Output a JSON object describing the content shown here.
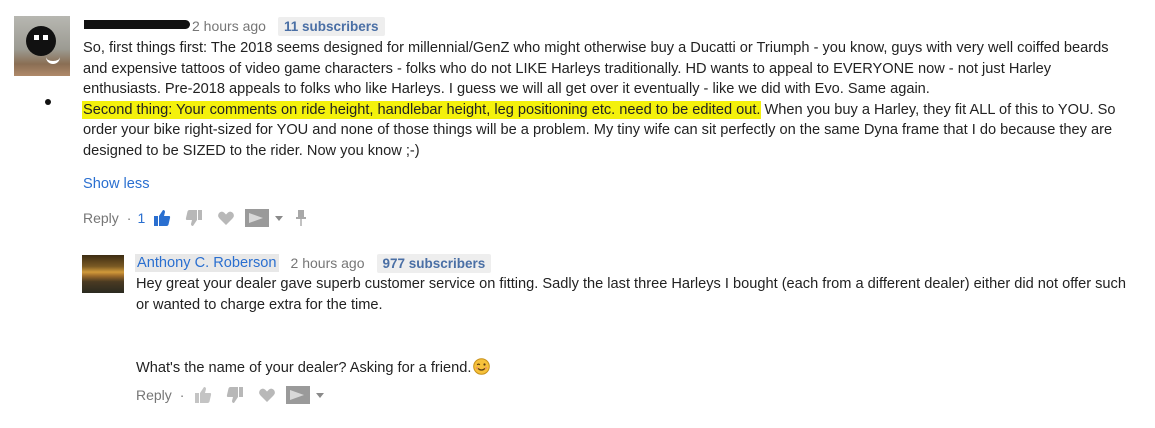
{
  "comment": {
    "time": "2 hours ago",
    "subscribers": "11 subscribers",
    "paragraph1": "So, first things first:  The 2018 seems designed for millennial/GenZ who might otherwise buy a Ducatti or Triumph - you know, guys with very well coiffed beards and expensive tattoos of video game characters - folks who do not LIKE Harleys traditionally.  HD wants to appeal to EVERYONE now - not just Harley enthusiasts.  Pre-2018 appeals to folks who like Harleys.  I guess we will all get over it eventually - like we did with Evo.  Same again.",
    "highlight": "Second thing:  Your comments on ride height, handlebar height, leg positioning etc. need to be edited out.",
    "paragraph2_rest": "  When you buy a Harley, they fit ALL of this to YOU.  So order your bike right-sized for YOU and none of those things will be a problem.  My tiny wife can sit perfectly on the same Dyna frame that I do because they are designed to be SIZED to the rider.  Now you know ;-)",
    "show_less": "Show less",
    "reply_label": "Reply",
    "separator": "·",
    "like_count": "1"
  },
  "reply": {
    "author": "Anthony C. Roberson",
    "time": "2 hours ago",
    "subscribers": "977 subscribers",
    "line1": "Hey great your dealer gave superb customer service on fitting. Sadly the last three Harleys I bought (each from a different dealer) either did not offer such or wanted to charge extra for the time.",
    "line2": "What's the name of your dealer? Asking for a friend.",
    "reply_label": "Reply",
    "separator": "·"
  },
  "colors": {
    "link_blue": "#2a6fd0",
    "highlight_yellow": "#f4f10c",
    "meta_gray": "#767676"
  },
  "icons": [
    "thumbs-up-icon",
    "thumbs-down-icon",
    "heart-icon",
    "flag-icon",
    "caret-down-icon",
    "pin-icon",
    "winking-emoji-icon"
  ]
}
